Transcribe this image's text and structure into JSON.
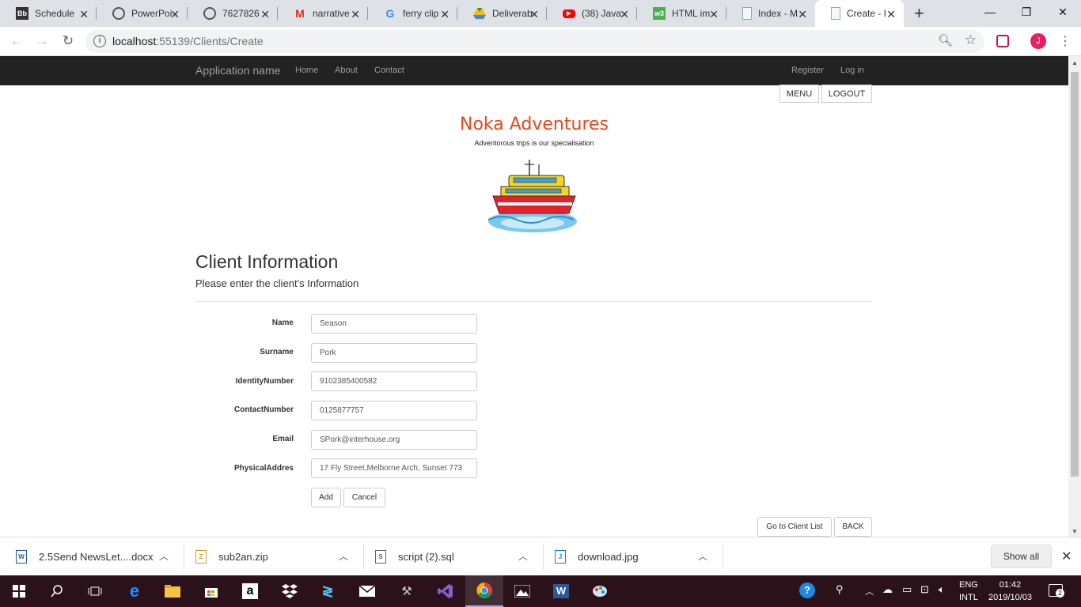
{
  "browser": {
    "tabs": [
      {
        "title": "Schedule",
        "icon": "blackboard-icon",
        "icon_text": "Bb"
      },
      {
        "title": "PowerPoi",
        "icon": "globe-icon",
        "icon_text": ""
      },
      {
        "title": "7627826",
        "icon": "globe-icon",
        "icon_text": ""
      },
      {
        "title": "narrative",
        "icon": "gmail-icon",
        "icon_text": "M"
      },
      {
        "title": "ferry clip",
        "icon": "google-icon",
        "icon_text": "G"
      },
      {
        "title": "Deliverab",
        "icon": "google-drive-icon",
        "icon_text": ""
      },
      {
        "title": "(38) Java",
        "icon": "youtube-icon",
        "icon_text": ""
      },
      {
        "title": "HTML im",
        "icon": "w3schools-icon",
        "icon_text": "w3"
      },
      {
        "title": "Index - M",
        "icon": "page-icon",
        "icon_text": ""
      },
      {
        "title": "Create - I",
        "icon": "page-icon",
        "icon_text": ""
      }
    ],
    "url_host": "localhost",
    "url_rest": ":55139/Clients/Create",
    "profile_initial": "J"
  },
  "page": {
    "navbar": {
      "brand": "Application name",
      "links": [
        "Home",
        "About",
        "Contact"
      ],
      "right_links": [
        "Register",
        "Log in"
      ]
    },
    "top_buttons": {
      "menu": "MENU",
      "logout": "LOGOUT"
    },
    "site_title": "Noka Adventures",
    "tagline": "Adventorous trips is our specialisation",
    "section_title": "Client Information",
    "section_subtitle": "Please enter the client's Information",
    "form": {
      "name": {
        "label": "Name",
        "value": "Season"
      },
      "surname": {
        "label": "Surname",
        "value": "Pork"
      },
      "identity": {
        "label": "IdentityNumber",
        "value": "9102385400582"
      },
      "contact": {
        "label": "ContactNumber",
        "value": "0125877757"
      },
      "email": {
        "label": "Email",
        "value": "SPork@interhouse.org"
      },
      "address": {
        "label": "PhysicalAddres",
        "value": "17 Fly Street,Melborne Arch, Sunset 773"
      },
      "add_label": "Add",
      "cancel_label": "Cancel"
    },
    "bottom_buttons": {
      "client_list": "Go to Client List",
      "back": "BACK"
    }
  },
  "downloads": {
    "items": [
      {
        "name": "2.5Send NewsLet....docx",
        "icon": "word-file-icon",
        "icon_text": "W"
      },
      {
        "name": "sub2an.zip",
        "icon": "zip-file-icon",
        "icon_text": "Z"
      },
      {
        "name": "script (2).sql",
        "icon": "sql-file-icon",
        "icon_text": "S"
      },
      {
        "name": "download.jpg",
        "icon": "image-file-icon",
        "icon_text": "J"
      }
    ],
    "show_all": "Show all"
  },
  "taskbar": {
    "lang_top": "ENG",
    "lang_bottom": "INTL",
    "time": "01:42",
    "date": "2019/10/03",
    "notification_count": "2"
  },
  "colors": {
    "navbar_bg": "#222222",
    "title_orange": "#e8461b",
    "taskbar_bg": "#2b1119"
  }
}
